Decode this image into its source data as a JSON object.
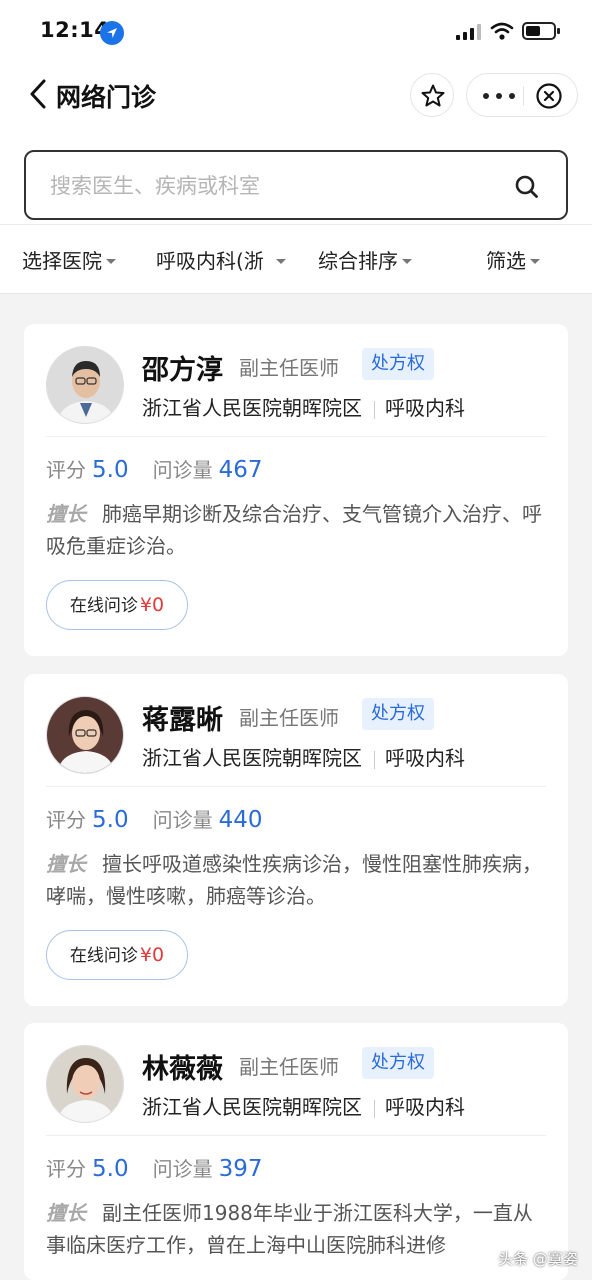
{
  "status_bar": {
    "time": "12:14"
  },
  "nav": {
    "title": "网络门诊"
  },
  "search": {
    "placeholder": "搜索医生、疾病或科室"
  },
  "filters": [
    {
      "label": "选择医院"
    },
    {
      "label": "呼吸内科(浙"
    },
    {
      "label": "综合排序"
    },
    {
      "label": "筛选"
    }
  ],
  "doctors": [
    {
      "name": "邵方淳",
      "title": "副主任医师",
      "badge": "处方权",
      "hospital": "浙江省人民医院朝晖院区",
      "department": "呼吸内科",
      "rating_label": "评分",
      "rating": "5.0",
      "consult_label": "问诊量",
      "consults": "467",
      "speciality_tag": "擅长",
      "speciality": "肺癌早期诊断及综合治疗、支气管镜介入治疗、呼吸危重症诊治。",
      "button_label": "在线问诊",
      "price": "¥0"
    },
    {
      "name": "蒋露晰",
      "title": "副主任医师",
      "badge": "处方权",
      "hospital": "浙江省人民医院朝晖院区",
      "department": "呼吸内科",
      "rating_label": "评分",
      "rating": "5.0",
      "consult_label": "问诊量",
      "consults": "440",
      "speciality_tag": "擅长",
      "speciality": "擅长呼吸道感染性疾病诊治，慢性阻塞性肺疾病，哮喘，慢性咳嗽，肺癌等诊治。",
      "button_label": "在线问诊",
      "price": "¥0"
    },
    {
      "name": "林薇薇",
      "title": "副主任医师",
      "badge": "处方权",
      "hospital": "浙江省人民医院朝晖院区",
      "department": "呼吸内科",
      "rating_label": "评分",
      "rating": "5.0",
      "consult_label": "问诊量",
      "consults": "397",
      "speciality_tag": "擅长",
      "speciality": "副主任医师1988年毕业于浙江医科大学，一直从事临床医疗工作，曾在上海中山医院肺科进修"
    }
  ],
  "watermark": "头条 @寞姿",
  "colors": {
    "accent": "#2a6bd8",
    "price": "#e23b3b",
    "badge_bg": "#e7f0fd"
  }
}
